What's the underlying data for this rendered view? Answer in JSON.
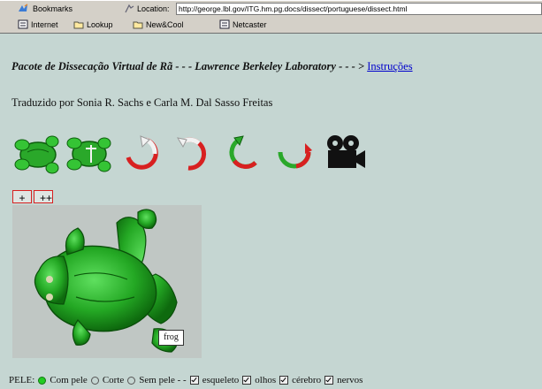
{
  "browser": {
    "toolbar": {
      "bookmarks_label": "Bookmarks",
      "location_label": "Location:",
      "url": "http://george.lbl.gov/ITG.hm.pg.docs/dissect/portuguese/dissect.html"
    },
    "personal_toolbar": {
      "items": [
        "Internet",
        "Lookup",
        "New&Cool",
        "Netcaster"
      ]
    }
  },
  "page": {
    "title": "Pacote de Dissecação Virtual de Rã - - - Lawrence Berkeley Laboratory - - - >",
    "instructions_link": "Instruções",
    "credit": "Traduzido por Sonia R. Sachs e Carla M. Dal Sasso Freitas"
  },
  "controls": {
    "icons": [
      "frog-view-icon",
      "frog-view-alt-icon",
      "rotate-left-icon",
      "rotate-right-icon",
      "rotate-back-icon",
      "rotate-forward-icon",
      "movie-camera-icon"
    ],
    "zoom_in": "+",
    "zoom_in_more": "++"
  },
  "viewer": {
    "label": "frog"
  },
  "options": {
    "pele_label": "PELE:",
    "com_pele": "Com pele",
    "corte": "Corte",
    "sem_pele": "Sem pele - -",
    "esqueleto": "esqueleto",
    "olhos": "olhos",
    "cerebro": "cérebro",
    "nervos": "nervos",
    "selected_skin": "Com pele",
    "accent_green": "#22b922",
    "accent_red": "#d82020"
  }
}
